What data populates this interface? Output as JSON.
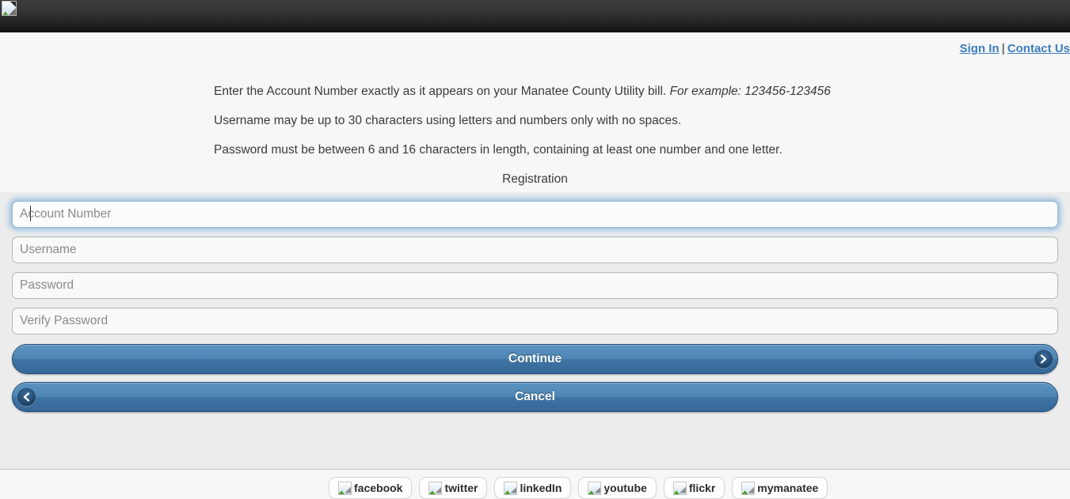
{
  "header": {
    "logo_icon": "broken-image-icon"
  },
  "account_links": {
    "sign_in": "Sign In",
    "separator": "|",
    "contact_us": "Contact Us"
  },
  "instructions": [
    {
      "text": "Enter the Account Number exactly as it appears on your Manatee County Utility bill. ",
      "emphasis": "For example: 123456-123456"
    },
    {
      "text": "Username may be up to 30 characters using letters and numbers only with no spaces.",
      "emphasis": ""
    },
    {
      "text": "Password must be between 6 and 16 characters in length, containing at least one number and one letter.",
      "emphasis": ""
    }
  ],
  "form": {
    "title": "Registration",
    "fields": [
      {
        "name": "account-number",
        "placeholder": "Account Number",
        "value": "",
        "focused": true
      },
      {
        "name": "username",
        "placeholder": "Username",
        "value": "",
        "focused": false
      },
      {
        "name": "password",
        "placeholder": "Password",
        "value": "",
        "focused": false
      },
      {
        "name": "verify-password",
        "placeholder": "Verify Password",
        "value": "",
        "focused": false
      }
    ],
    "continue_label": "Continue",
    "continue_icon": "chevron-right-icon",
    "cancel_label": "Cancel",
    "cancel_icon": "chevron-left-icon"
  },
  "footer": {
    "social": [
      {
        "label": "facebook",
        "icon": "broken-image-icon"
      },
      {
        "label": "twitter",
        "icon": "broken-image-icon"
      },
      {
        "label": "linkedIn",
        "icon": "broken-image-icon"
      },
      {
        "label": "youtube",
        "icon": "broken-image-icon"
      },
      {
        "label": "flickr",
        "icon": "broken-image-icon"
      },
      {
        "label": "mymanatee",
        "icon": "broken-image-icon"
      }
    ]
  },
  "colors": {
    "link": "#3d7ebd",
    "button_blue": "#4d86b4",
    "panel_bg": "#ececec",
    "page_bg": "#f7f7f7",
    "topbar": "#222222"
  }
}
